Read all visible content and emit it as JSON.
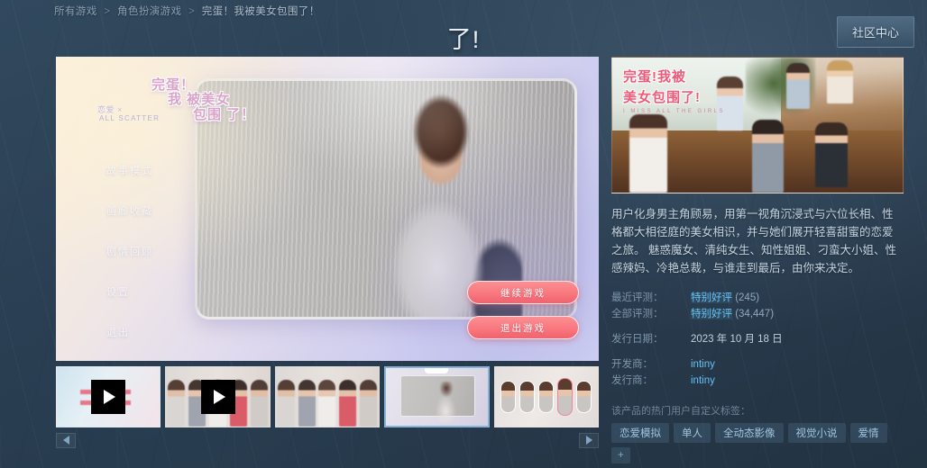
{
  "header": {
    "breadcrumb": [
      "所有游戏",
      "角色扮演游戏",
      "完蛋！我被美女包围了！"
    ],
    "page_title": "了!",
    "community_button": "社区中心"
  },
  "player": {
    "logo": {
      "line1": "完蛋！",
      "line2": "我 被美女",
      "line3": "包围 了！",
      "sub": "恋爱 ×",
      "sub2": "ALL SCATTER"
    },
    "menu_items": [
      "故事模式",
      "画廊收藏",
      "剧情回顾",
      "设置",
      "退出"
    ],
    "action_buttons": [
      "继续游戏",
      "退出游戏"
    ],
    "thumbnails": [
      {
        "type": "video",
        "selected": false
      },
      {
        "type": "video",
        "selected": false
      },
      {
        "type": "image",
        "selected": false
      },
      {
        "type": "image",
        "selected": true
      },
      {
        "type": "image",
        "selected": false
      }
    ],
    "carousel": {
      "prev": "◀",
      "next": "▶"
    }
  },
  "info": {
    "header_logo": {
      "line1": "完蛋!我被",
      "line2": "美女包围了!",
      "sub": "I MISS ALL THE GIRLS"
    },
    "description": "用户化身男主角顾易，用第一视角沉浸式与六位长相、性格都大相径庭的美女相识，并与她们展开轻喜甜蜜的恋爱之旅。 魅惑魔女、清纯女生、知性姐姐、刁蛮大小姐、性感辣妈、冷艳总裁，与谁走到最后，由你来决定。",
    "meta": {
      "recent_reviews_label": "最近评测：",
      "recent_reviews_value": "特别好评",
      "recent_reviews_count": "(245)",
      "all_reviews_label": "全部评测：",
      "all_reviews_value": "特别好评",
      "all_reviews_count": "(34,447)",
      "release_date_label": "发行日期：",
      "release_date_value": "2023 年 10 月 18 日",
      "developer_label": "开发商：",
      "developer_value": "intiny",
      "publisher_label": "发行商：",
      "publisher_value": "intiny"
    },
    "tags_heading": "该产品的热门用户自定义标签：",
    "tags": [
      "恋爱模拟",
      "单人",
      "全动态影像",
      "视觉小说",
      "爱情",
      "+"
    ]
  },
  "colors": {
    "page_bg": "#2b3f52",
    "accent_blue": "#66c0f4",
    "pink_button": "#f9787f",
    "logo_pink": "#f05a78"
  }
}
